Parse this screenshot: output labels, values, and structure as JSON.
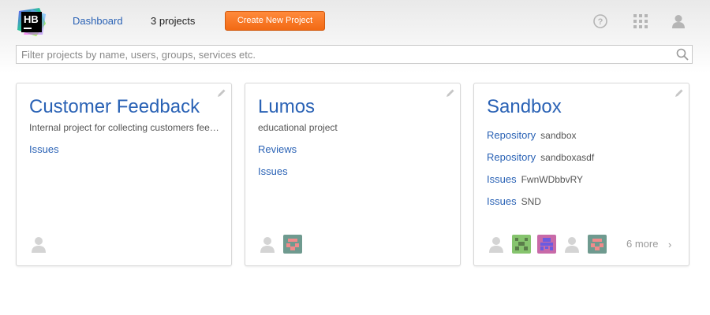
{
  "header": {
    "logo_text": "HB",
    "nav_dashboard": "Dashboard",
    "project_count": "3 projects",
    "create_button": "Create New Project"
  },
  "search": {
    "placeholder": "Filter projects by name, users, groups, services etc."
  },
  "icons": {
    "help": "help-circle-icon",
    "apps": "apps-grid-icon",
    "user": "user-avatar-icon",
    "search": "magnifier-icon",
    "edit": "pencil-icon"
  },
  "colors": {
    "link": "#2a62b5",
    "accent": "#f26a14"
  },
  "projects": [
    {
      "name": "Customer Feedback",
      "description": "Internal project for collecting customers feedback",
      "services": [
        {
          "label": "Issues",
          "value": ""
        }
      ]
    },
    {
      "name": "Lumos",
      "description": "educational project",
      "services": [
        {
          "label": "Reviews",
          "value": ""
        },
        {
          "label": "Issues",
          "value": ""
        }
      ]
    },
    {
      "name": "Sandbox",
      "description": "",
      "services": [
        {
          "label": "Repository",
          "value": "sandbox"
        },
        {
          "label": "Repository",
          "value": "sandboxasdf"
        },
        {
          "label": "Issues",
          "value": "FwnWDbbvRY"
        },
        {
          "label": "Issues",
          "value": "SND"
        }
      ],
      "more_members": "6 more"
    }
  ]
}
